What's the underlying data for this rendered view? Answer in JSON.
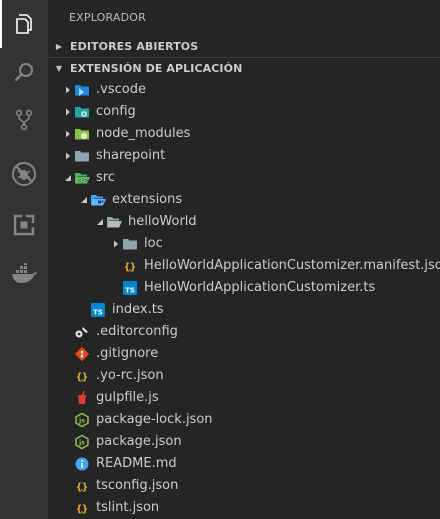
{
  "sidebar": {
    "title": "EXPLORADOR",
    "sections": {
      "open_editors": "EDITORES ABIERTOS",
      "workspace": "EXTENSIÓN DE APLICACIÓN"
    }
  },
  "activity_bar": {
    "items": [
      "files-icon",
      "search-icon",
      "source-control-icon",
      "debug-icon",
      "extensions-icon",
      "docker-icon"
    ]
  },
  "tree": [
    {
      "label": ".vscode",
      "depth": 0,
      "kind": "folder",
      "expanded": false,
      "icon": "vscode-folder-icon"
    },
    {
      "label": "config",
      "depth": 0,
      "kind": "folder",
      "expanded": false,
      "icon": "config-folder-icon"
    },
    {
      "label": "node_modules",
      "depth": 0,
      "kind": "folder",
      "expanded": false,
      "icon": "node-folder-icon"
    },
    {
      "label": "sharepoint",
      "depth": 0,
      "kind": "folder",
      "expanded": false,
      "icon": "folder-icon"
    },
    {
      "label": "src",
      "depth": 0,
      "kind": "folder",
      "expanded": true,
      "icon": "src-folder-icon"
    },
    {
      "label": "extensions",
      "depth": 1,
      "kind": "folder",
      "expanded": true,
      "icon": "extensions-folder-icon"
    },
    {
      "label": "helloWorld",
      "depth": 2,
      "kind": "folder",
      "expanded": true,
      "icon": "folder-open-icon"
    },
    {
      "label": "loc",
      "depth": 3,
      "kind": "folder",
      "expanded": false,
      "icon": "folder-icon"
    },
    {
      "label": "HelloWorldApplicationCustomizer.manifest.json",
      "depth": 3,
      "kind": "file",
      "icon": "json-icon"
    },
    {
      "label": "HelloWorldApplicationCustomizer.ts",
      "depth": 3,
      "kind": "file",
      "icon": "typescript-icon"
    },
    {
      "label": "index.ts",
      "depth": 1,
      "kind": "file",
      "icon": "typescript-icon"
    },
    {
      "label": ".editorconfig",
      "depth": 0,
      "kind": "file",
      "icon": "editorconfig-icon"
    },
    {
      "label": ".gitignore",
      "depth": 0,
      "kind": "file",
      "icon": "git-icon"
    },
    {
      "label": ".yo-rc.json",
      "depth": 0,
      "kind": "file",
      "icon": "json-icon"
    },
    {
      "label": "gulpfile.js",
      "depth": 0,
      "kind": "file",
      "icon": "gulp-icon"
    },
    {
      "label": "package-lock.json",
      "depth": 0,
      "kind": "file",
      "icon": "npm-package-icon"
    },
    {
      "label": "package.json",
      "depth": 0,
      "kind": "file",
      "icon": "npm-package-icon"
    },
    {
      "label": "README.md",
      "depth": 0,
      "kind": "file",
      "icon": "info-icon"
    },
    {
      "label": "tsconfig.json",
      "depth": 0,
      "kind": "file",
      "icon": "json-icon"
    },
    {
      "label": "tslint.json",
      "depth": 0,
      "kind": "file",
      "icon": "json-icon"
    }
  ],
  "colors": {
    "activity_bar": "#333333",
    "sidebar": "#252526",
    "folder": "#90a4ae",
    "typescript": "#0288d1",
    "json": "#fbc02d",
    "git": "#e64a19",
    "gulp": "#e53935",
    "npm_package": "#8bc34a",
    "info": "#42a5f5"
  }
}
